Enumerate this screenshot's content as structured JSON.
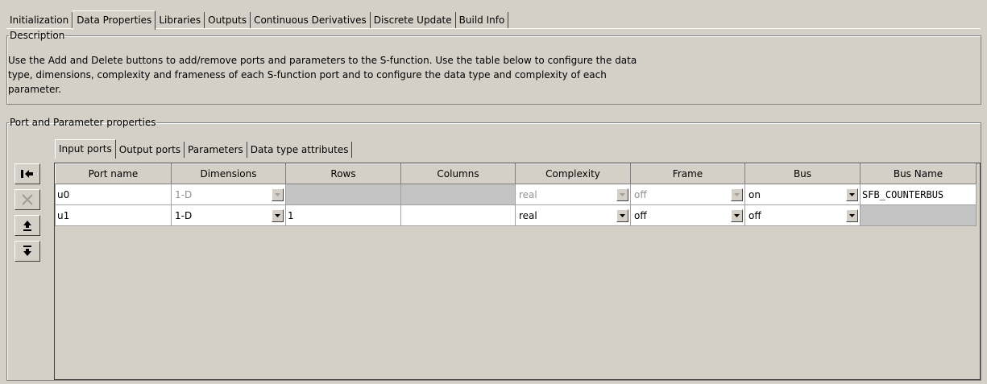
{
  "top_tabs": [
    "Initialization",
    "Data Properties",
    "Libraries",
    "Outputs",
    "Continuous Derivatives",
    "Discrete Update",
    "Build Info"
  ],
  "description": {
    "legend": "Description",
    "text": "Use the Add and Delete buttons to add/remove ports and parameters to the S-function. Use the table below to configure the data type, dimensions, complexity and frameness of each S-function port and to configure the data type and complexity of each parameter."
  },
  "port_props": {
    "legend": "Port and Parameter properties",
    "tabs": [
      "Input ports",
      "Output ports",
      "Parameters",
      "Data type attributes"
    ],
    "buttons": [
      {
        "name": "add-port-button",
        "icon": "add-icon",
        "enabled": true
      },
      {
        "name": "delete-port-button",
        "icon": "delete-icon",
        "enabled": false
      },
      {
        "name": "move-up-button",
        "icon": "move-up-icon",
        "enabled": true
      },
      {
        "name": "move-down-button",
        "icon": "move-down-icon",
        "enabled": true
      }
    ]
  },
  "table": {
    "columns": [
      "Port name",
      "Dimensions",
      "Rows",
      "Columns",
      "Complexity",
      "Frame",
      "Bus",
      "Bus Name"
    ],
    "rows": [
      {
        "port_name": "u0",
        "dimensions": "1-D",
        "rows": "",
        "columns": "",
        "complexity": "real",
        "frame": "off",
        "bus": "on",
        "bus_name": "SFB_COUNTERBUS"
      },
      {
        "port_name": "u1",
        "dimensions": "1-D",
        "rows": "1",
        "columns": "",
        "complexity": "real",
        "frame": "off",
        "bus": "off",
        "bus_name": ""
      }
    ]
  }
}
